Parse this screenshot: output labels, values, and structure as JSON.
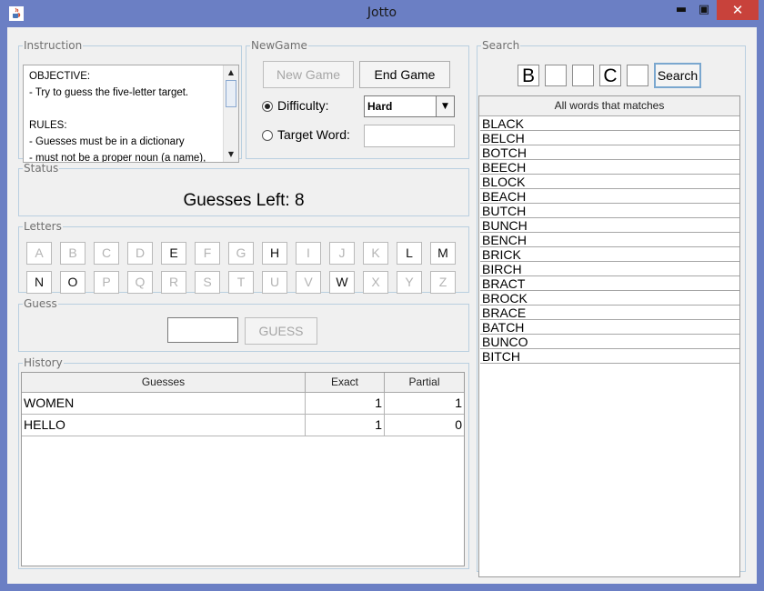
{
  "window": {
    "title": "Jotto"
  },
  "instruction": {
    "legend": "Instruction",
    "lines": [
      "OBJECTIVE:",
      "- Try to guess the five-letter target.",
      "",
      "RULES:",
      "- Guesses must be in a dictionary",
      "- must not be a proper noun (a name),"
    ]
  },
  "newgame": {
    "legend": "NewGame",
    "new_game_label": "New Game",
    "end_game_label": "End Game",
    "difficulty_label": "Difficulty:",
    "difficulty_value": "Hard",
    "target_word_label": "Target Word:",
    "target_word_value": ""
  },
  "status": {
    "legend": "Status",
    "text": "Guesses Left: 8"
  },
  "letters": {
    "legend": "Letters",
    "items": [
      {
        "letter": "A",
        "active": false
      },
      {
        "letter": "B",
        "active": false
      },
      {
        "letter": "C",
        "active": false
      },
      {
        "letter": "D",
        "active": false
      },
      {
        "letter": "E",
        "active": true
      },
      {
        "letter": "F",
        "active": false
      },
      {
        "letter": "G",
        "active": false
      },
      {
        "letter": "H",
        "active": true
      },
      {
        "letter": "I",
        "active": false
      },
      {
        "letter": "J",
        "active": false
      },
      {
        "letter": "K",
        "active": false
      },
      {
        "letter": "L",
        "active": true
      },
      {
        "letter": "M",
        "active": true
      },
      {
        "letter": "N",
        "active": true
      },
      {
        "letter": "O",
        "active": true
      },
      {
        "letter": "P",
        "active": false
      },
      {
        "letter": "Q",
        "active": false
      },
      {
        "letter": "R",
        "active": false
      },
      {
        "letter": "S",
        "active": false
      },
      {
        "letter": "T",
        "active": false
      },
      {
        "letter": "U",
        "active": false
      },
      {
        "letter": "V",
        "active": false
      },
      {
        "letter": "W",
        "active": true
      },
      {
        "letter": "X",
        "active": false
      },
      {
        "letter": "Y",
        "active": false
      },
      {
        "letter": "Z",
        "active": false
      }
    ]
  },
  "guess": {
    "legend": "Guess",
    "input_value": "",
    "button_label": "GUESS"
  },
  "history": {
    "legend": "History",
    "columns": [
      "Guesses",
      "Exact",
      "Partial"
    ],
    "rows": [
      {
        "guess": "WOMEN",
        "exact": "1",
        "partial": "1"
      },
      {
        "guess": "HELLO",
        "exact": "1",
        "partial": "0"
      }
    ]
  },
  "search": {
    "legend": "Search",
    "boxes": [
      "B",
      "",
      "",
      "C",
      ""
    ],
    "button_label": "Search",
    "results_header": "All words that matches",
    "results": [
      "BLACK",
      "BELCH",
      "BOTCH",
      "BEECH",
      "BLOCK",
      "BEACH",
      "BUTCH",
      "BUNCH",
      "BENCH",
      "BRICK",
      "BIRCH",
      "BRACT",
      "BROCK",
      "BRACE",
      "BATCH",
      "BUNCO",
      "BITCH"
    ]
  },
  "colors": {
    "titlebar": "#6b7fc4",
    "close_button": "#c8423b",
    "panel_border": "#b9cfe0"
  }
}
